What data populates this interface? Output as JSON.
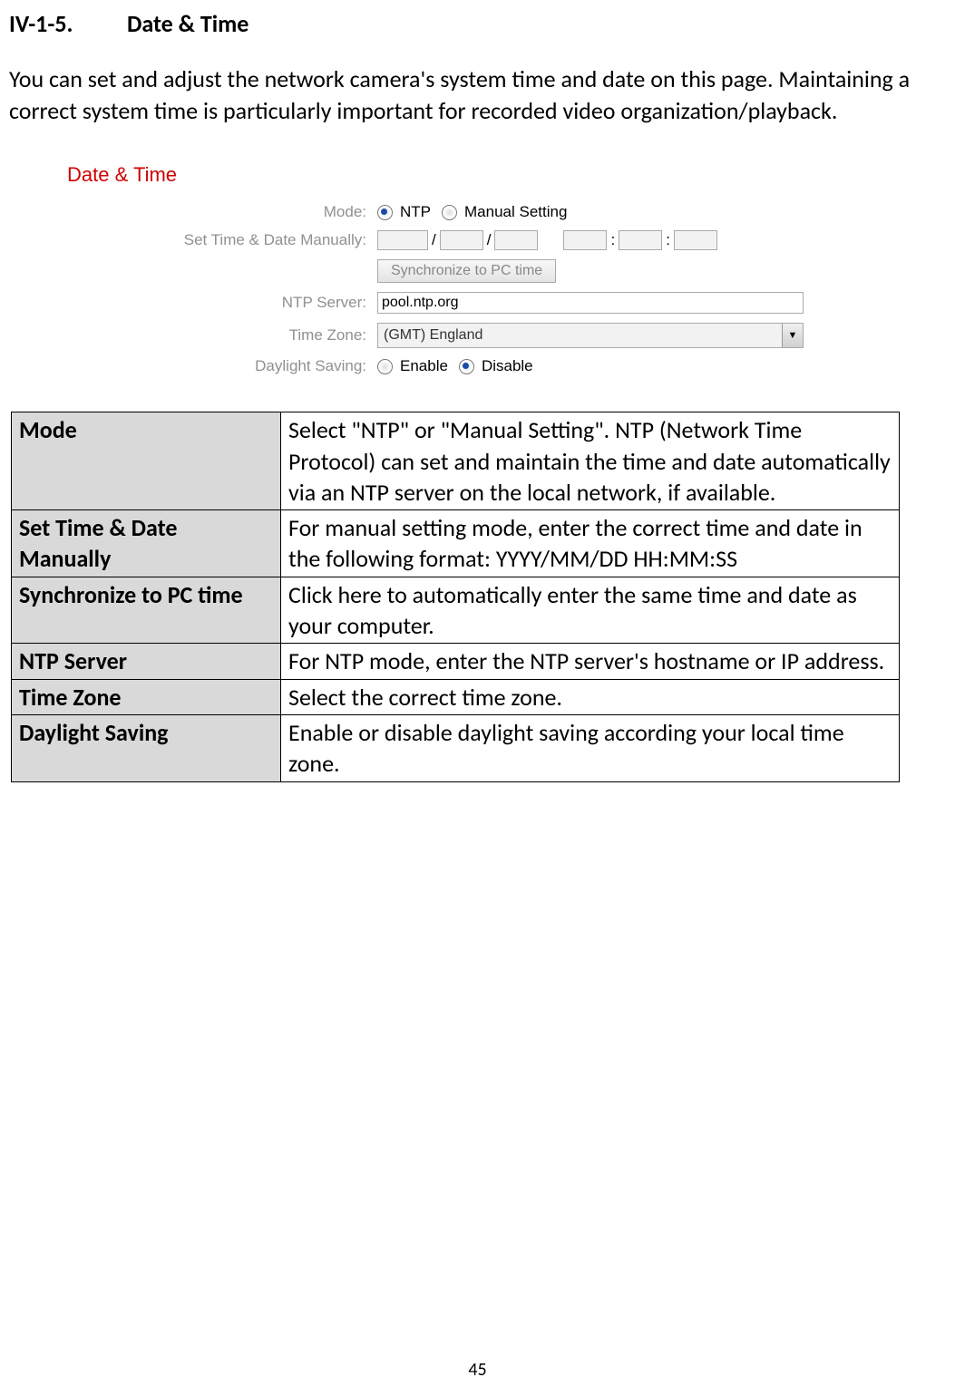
{
  "heading": {
    "number": "IV-1-5.",
    "title": "Date & Time"
  },
  "intro": "You can set and adjust the network camera's system time and date on this page. Maintaining a correct system time is particularly important for recorded video organization/playback.",
  "form": {
    "title": "Date & Time",
    "mode_label": "Mode:",
    "mode_ntp": "NTP",
    "mode_manual": "Manual Setting",
    "manual_label": "Set Time & Date Manually:",
    "sync_button": "Synchronize to PC time",
    "ntp_label": "NTP Server:",
    "ntp_value": "pool.ntp.org",
    "tz_label": "Time Zone:",
    "tz_value": "(GMT) England",
    "dst_label": "Daylight Saving:",
    "dst_enable": "Enable",
    "dst_disable": "Disable",
    "slash": "/",
    "colon": ":"
  },
  "rows": [
    {
      "term": "Mode",
      "desc": "Select \"NTP\" or \"Manual Setting\". NTP (Network Time Protocol) can set and maintain the time and date automatically via an NTP server on the local network, if available."
    },
    {
      "term": "Set Time & Date Manually",
      "desc": "For manual setting mode, enter the correct time and date in the following format: YYYY/MM/DD HH:MM:SS"
    },
    {
      "term": "Synchronize to PC time",
      "desc": "Click here to automatically enter the same time and date as your computer."
    },
    {
      "term": "NTP Server",
      "desc": "For NTP mode, enter the NTP server's hostname or IP address."
    },
    {
      "term": "Time Zone",
      "desc": "Select the correct time zone."
    },
    {
      "term": "Daylight Saving",
      "desc": "Enable or disable daylight saving according your local time zone."
    }
  ],
  "page_number": "45"
}
